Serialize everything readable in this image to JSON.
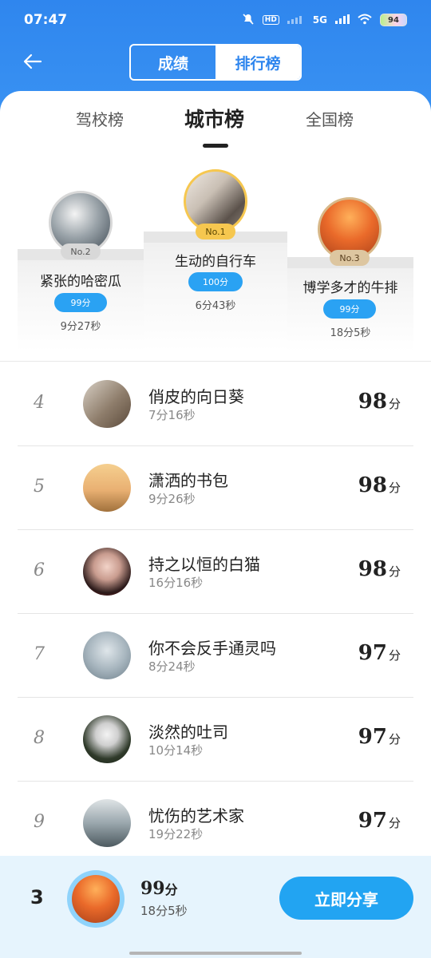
{
  "status_bar": {
    "time": "07:47",
    "network": "5G",
    "battery": "94"
  },
  "header": {
    "segments": [
      {
        "label": "成绩"
      },
      {
        "label": "排行榜"
      }
    ]
  },
  "tabs": [
    {
      "label": "驾校榜"
    },
    {
      "label": "城市榜"
    },
    {
      "label": "全国榜"
    }
  ],
  "podium": {
    "first": {
      "rank": "No.1",
      "name": "生动的自行车",
      "score": "100分",
      "time": "6分43秒"
    },
    "second": {
      "rank": "No.2",
      "name": "紧张的哈密瓜",
      "score": "99分",
      "time": "9分27秒"
    },
    "third": {
      "rank": "No.3",
      "name": "博学多才的牛排",
      "score": "99分",
      "time": "18分5秒"
    }
  },
  "ranking_list": [
    {
      "rank": "4",
      "name": "俏皮的向日葵",
      "time": "7分16秒",
      "score": "98",
      "unit": "分"
    },
    {
      "rank": "5",
      "name": "潇洒的书包",
      "time": "9分26秒",
      "score": "98",
      "unit": "分"
    },
    {
      "rank": "6",
      "name": "持之以恒的白猫",
      "time": "16分16秒",
      "score": "98",
      "unit": "分"
    },
    {
      "rank": "7",
      "name": "你不会反手通灵吗",
      "time": "8分24秒",
      "score": "97",
      "unit": "分"
    },
    {
      "rank": "8",
      "name": "淡然的吐司",
      "time": "10分14秒",
      "score": "97",
      "unit": "分"
    },
    {
      "rank": "9",
      "name": "忧伤的艺术家",
      "time": "19分22秒",
      "score": "97",
      "unit": "分"
    }
  ],
  "my_entry": {
    "rank": "3",
    "score": "99",
    "unit": "分",
    "time": "18分5秒",
    "share_label": "立即分享"
  }
}
